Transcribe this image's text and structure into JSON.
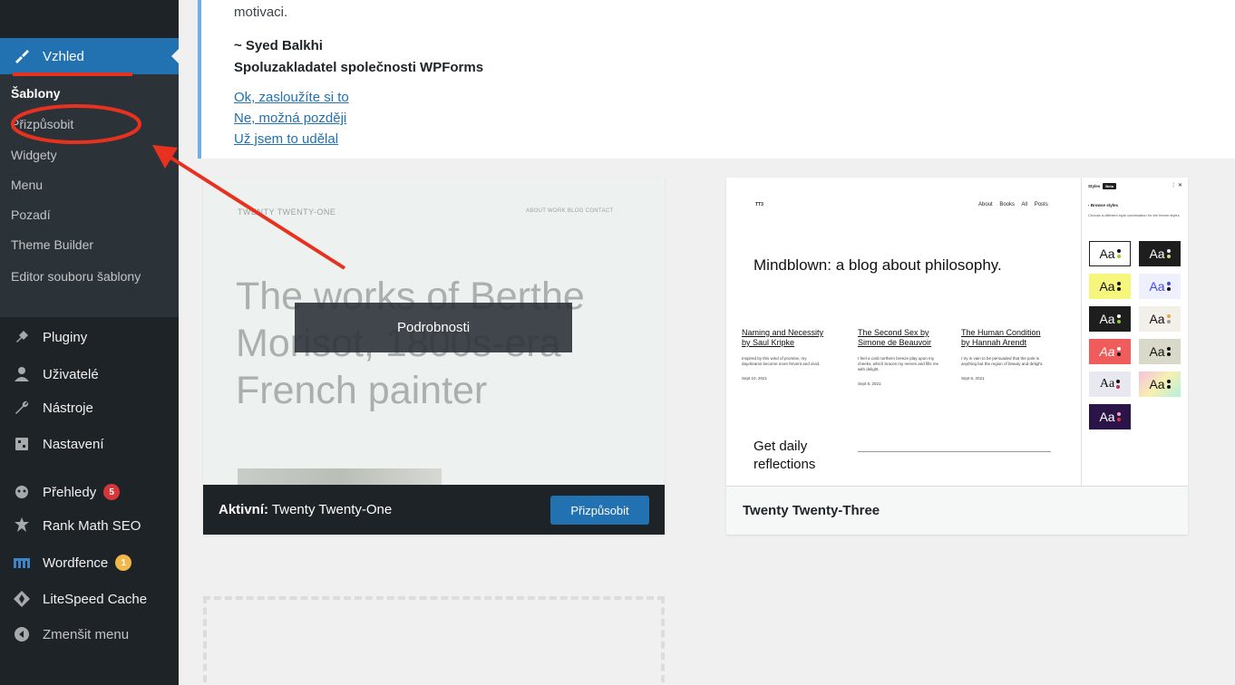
{
  "sidebar": {
    "vzhled": "Vzhled",
    "submenu": [
      "Šablony",
      "Přizpůsobit",
      "Widgety",
      "Menu",
      "Pozadí",
      "Theme Builder",
      "Editor souboru šablony"
    ],
    "items": [
      {
        "label": "Pluginy",
        "icon": "plugin-icon"
      },
      {
        "label": "Uživatelé",
        "icon": "users-icon"
      },
      {
        "label": "Nástroje",
        "icon": "wrench-icon"
      },
      {
        "label": "Nastavení",
        "icon": "settings-icon"
      },
      {
        "label": "Přehledy",
        "icon": "monsterinsights-icon",
        "badge": "5"
      },
      {
        "label": "Rank Math SEO",
        "icon": "rank-math-icon"
      },
      {
        "label": "Wordfence",
        "icon": "wordfence-icon",
        "badge": "1"
      },
      {
        "label": "LiteSpeed Cache",
        "icon": "litespeed-icon"
      },
      {
        "label": "Zmenšit menu",
        "icon": "collapse-icon"
      }
    ]
  },
  "notice": {
    "text_fragment": "motivaci.",
    "author": "~ Syed Balkhi",
    "author_role": "Spoluzakladatel společnosti WPForms",
    "links": [
      "Ok, zasloužíte si to",
      "Ne, možná později",
      "Už jsem to udělal"
    ]
  },
  "themes": {
    "active": {
      "preview_brand": "TWENTY TWENTY-ONE",
      "preview_nav": "ABOUT   WORK   BLOG   CONTACT",
      "preview_hero": "The works of Berthe Morisot, 1800s-era French painter",
      "details_label": "Podrobnosti",
      "active_prefix": "Aktivní:",
      "name": "Twenty Twenty-One",
      "customize_label": "Přizpůsobit"
    },
    "second": {
      "name": "Twenty Twenty-Three",
      "preview_logo": "TT3",
      "preview_nav": "About Books All Posts",
      "preview_title": "Mindblown: a blog about philosophy.",
      "posts": [
        {
          "title": "Naming and Necessity by Saul Kripke",
          "excerpt": "Inspired by this wind of promise, my daydreams become more fervent and vivid.",
          "date": "Sept 10, 2021"
        },
        {
          "title": "The Second Sex by Simone de Beauvoir",
          "excerpt": "I feel a cold northern breeze play upon my cheeks, which braces my nerves and fills me with delight.",
          "date": "Sept 8, 2021"
        },
        {
          "title": "The Human Condition by Hannah Arendt",
          "excerpt": "I try in vain to be persuaded that the pole is anything but the region of beauty and delight.",
          "date": "Sept 6, 2021"
        }
      ],
      "daily": "Get daily reflections",
      "styles_title": "Styles",
      "styles_beta": "Beta",
      "browse_styles": "Browse styles",
      "styles_desc": "Choose a different style combination for the theme styles",
      "swatch_label": "Aa"
    }
  },
  "colors": {
    "sidebar_bg": "#1d2327",
    "accent": "#2271b1",
    "annotation_red": "#e8321f"
  }
}
